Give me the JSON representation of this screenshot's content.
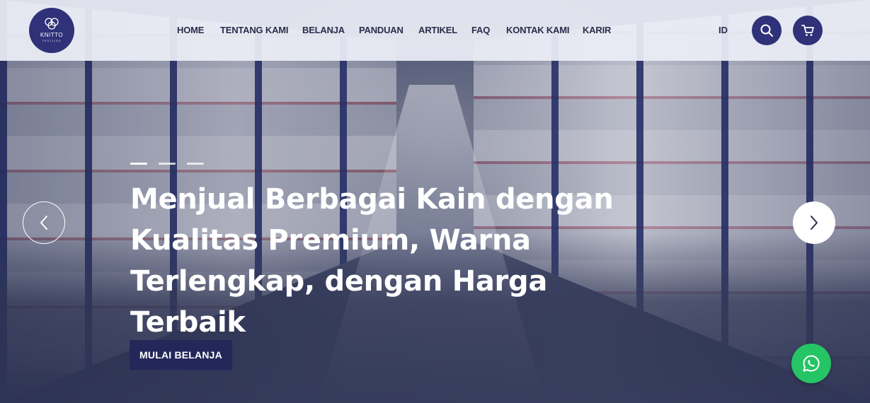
{
  "logo": {
    "brand": "KNITTO",
    "sub": "TEXTILES"
  },
  "nav": {
    "items": [
      {
        "label": "HOME"
      },
      {
        "label": "TENTANG KAMI"
      },
      {
        "label": "BELANJA"
      },
      {
        "label": "PANDUAN"
      },
      {
        "label": "ARTIKEL"
      },
      {
        "label": "FAQ"
      },
      {
        "label": "KONTAK KAMI"
      },
      {
        "label": "KARIR"
      }
    ],
    "language": "ID"
  },
  "icons": {
    "search": "search-icon",
    "cart": "cart-icon",
    "prev": "chevron-left-icon",
    "next": "chevron-right-icon",
    "whatsapp": "whatsapp-icon"
  },
  "hero": {
    "slide_count": 3,
    "active_slide": 1,
    "headline": "Menjual Berbagai Kain dengan Kualitas Premium, Warna Terlengkap, dengan Harga Terbaik",
    "cta_label": "MULAI BELANJA"
  },
  "colors": {
    "brand": "#2f3278",
    "cta": "#23275a",
    "whatsapp": "#25c464",
    "header_bg": "#eceef6"
  }
}
